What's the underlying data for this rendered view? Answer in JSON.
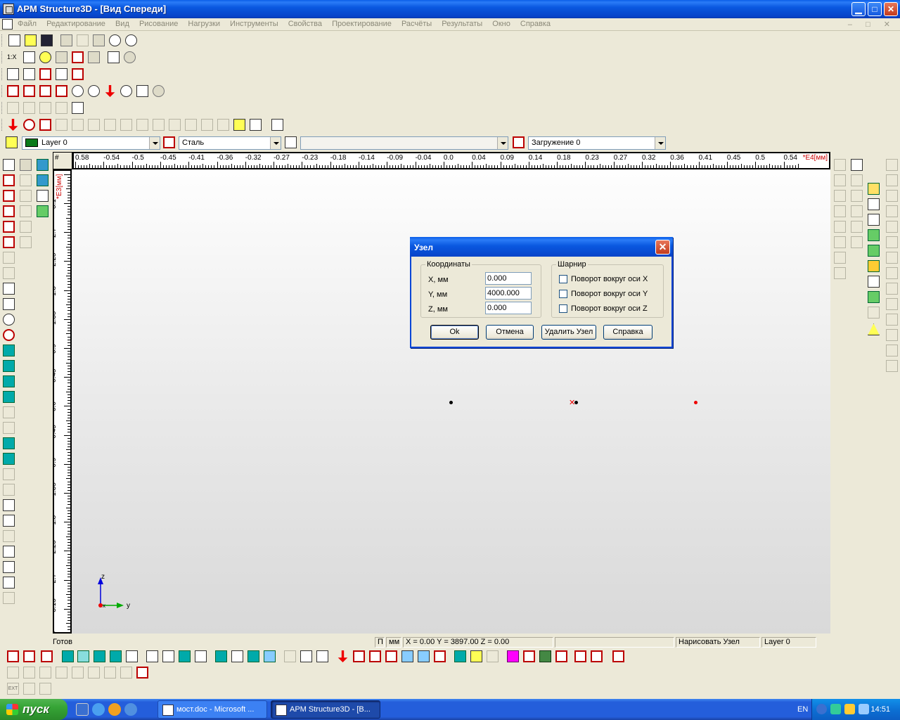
{
  "window": {
    "title": "APM Structure3D - [Вид Спереди]",
    "min_label": "▁",
    "max_label": "□",
    "close_label": "✕"
  },
  "menu": {
    "items": [
      "Файл",
      "Редактирование",
      "Вид",
      "Рисование",
      "Нагрузки",
      "Инструменты",
      "Свойства",
      "Проектирование",
      "Расчёты",
      "Результаты",
      "Окно",
      "Справка"
    ],
    "mdi_controls": "– □ ✕"
  },
  "toolbar_texts": {
    "one_x": "1:X"
  },
  "propbar": {
    "layer": "Layer 0",
    "material": "Сталь",
    "section": "",
    "load": "Загружение 0"
  },
  "ruler": {
    "top_labels": [
      "0.58",
      "-0.54",
      "-0.5",
      "-0.45",
      "-0.41",
      "-0.36",
      "-0.32",
      "-0.27",
      "-0.23",
      "-0.18",
      "-0.14",
      "-0.09",
      "-0.04",
      "0.0",
      "0.04",
      "0.09",
      "0.14",
      "0.18",
      "0.23",
      "0.27",
      "0.32",
      "0.36",
      "0.41",
      "0.45",
      "0.5",
      "0.54"
    ],
    "top_unit": "*E4[мм]",
    "left_unit": "*E3[мм]",
    "left_labels": [
      "3.1",
      "2.7",
      "2.25",
      "1.8",
      "1.35",
      "0.9",
      "0.45",
      "0.0",
      "-0.45",
      "-0.9",
      "-1.35",
      "-1.8",
      "-2.25",
      "-2.7",
      "-3.15",
      "-3.6"
    ],
    "corner": "#"
  },
  "axes": {
    "z": "z",
    "y": "y",
    "x": "x"
  },
  "dialog": {
    "title": "Узел",
    "coords_legend": "Координаты",
    "fields": [
      {
        "label": "X, мм",
        "value": "0.000"
      },
      {
        "label": "Y, мм",
        "value": "4000.000"
      },
      {
        "label": "Z, мм",
        "value": "0.000"
      }
    ],
    "hinge_legend": "Шарнир",
    "hinges": [
      "Поворот вокруг оси X",
      "Поворот вокруг оси Y",
      "Поворот вокруг оси Z"
    ],
    "buttons": {
      "ok": "Ok",
      "cancel": "Отмена",
      "delete": "Удалить Узел",
      "help": "Справка"
    }
  },
  "status": {
    "ready": "Готов",
    "mode": "П",
    "units": "мм",
    "coords": "X = 0.00 Y = 3897.00 Z = 0.00",
    "action": "Нарисовать Узел",
    "layer": "Layer 0"
  },
  "bottom_toolbar": {
    "ext": "EXT"
  },
  "taskbar": {
    "start": "пуск",
    "tasks": [
      "мост.doc - Microsoft ...",
      "APM Structure3D - [В..."
    ],
    "lang": "EN",
    "time": "14:51"
  },
  "colors": {
    "accent": "#0a5ee8",
    "node_red": "#e00000",
    "node_black": "#000000",
    "layer_swatch": "#0a7a1a"
  }
}
